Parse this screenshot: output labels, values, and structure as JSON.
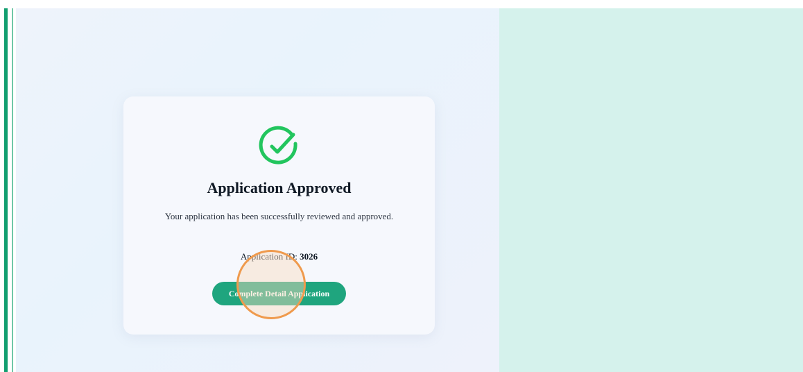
{
  "colors": {
    "accent": "#119e6f",
    "success_icon": "#22c55e",
    "button_bg": "#1fa57e",
    "right_pane_bg": "#d5f2ec",
    "click_marker": "#ef9a4d"
  },
  "card": {
    "icon": "check-circle-icon",
    "title": "Application Approved",
    "message": "Your application has been successfully reviewed and approved.",
    "application_id_label": "Application ID:",
    "application_id_value": "3026",
    "button_label": "Complete Detail Application"
  }
}
